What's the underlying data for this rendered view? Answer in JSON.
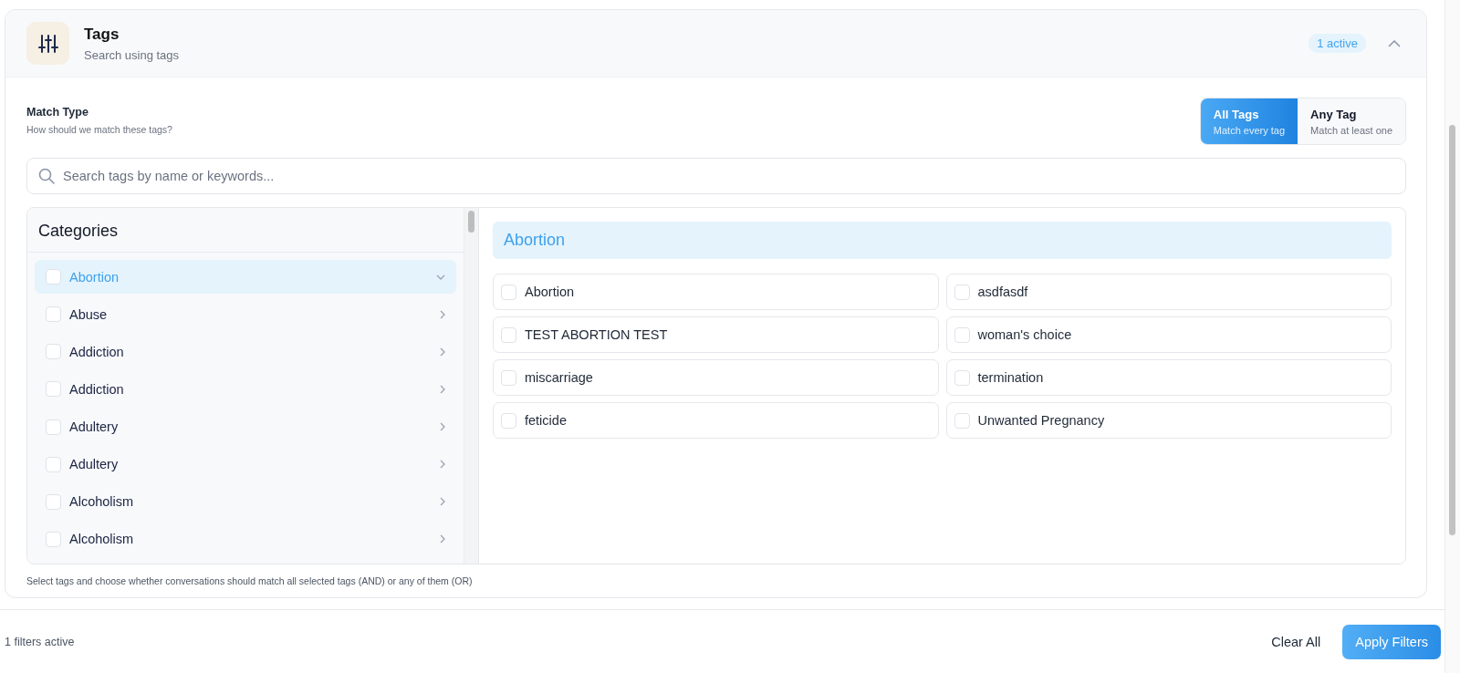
{
  "section": {
    "title": "Tags",
    "subtitle": "Search using tags",
    "badge": "1 active",
    "expanded": true
  },
  "match_type": {
    "label": "Match Type",
    "hint": "How should we match these tags?",
    "options": [
      {
        "label": "All Tags",
        "description": "Match every tag",
        "selected": true
      },
      {
        "label": "Any Tag",
        "description": "Match at least one",
        "selected": false
      }
    ]
  },
  "search": {
    "placeholder": "Search tags by name or keywords..."
  },
  "categories": {
    "title": "Categories",
    "items": [
      {
        "label": "Abortion",
        "checked": false,
        "selected": true,
        "expanded": true
      },
      {
        "label": "Abuse",
        "checked": false,
        "selected": false,
        "expanded": false
      },
      {
        "label": "Addiction",
        "checked": false,
        "selected": false,
        "expanded": false
      },
      {
        "label": "Addiction",
        "checked": false,
        "selected": false,
        "expanded": false
      },
      {
        "label": "Adultery",
        "checked": false,
        "selected": false,
        "expanded": false
      },
      {
        "label": "Adultery",
        "checked": false,
        "selected": false,
        "expanded": false
      },
      {
        "label": "Alcoholism",
        "checked": false,
        "selected": false,
        "expanded": false
      },
      {
        "label": "Alcoholism",
        "checked": false,
        "selected": false,
        "expanded": false
      }
    ]
  },
  "tag_panel": {
    "title": "Abortion",
    "tags": [
      {
        "label": "Abortion",
        "checked": false
      },
      {
        "label": "asdfasdf",
        "checked": false
      },
      {
        "label": "TEST ABORTION TEST",
        "checked": false
      },
      {
        "label": "woman's choice",
        "checked": false
      },
      {
        "label": "miscarriage",
        "checked": false
      },
      {
        "label": "termination",
        "checked": false
      },
      {
        "label": "feticide",
        "checked": false
      },
      {
        "label": "Unwanted Pregnancy",
        "checked": false
      }
    ]
  },
  "help_text": "Select tags and choose whether conversations should match all selected tags (AND) or any of them (OR)",
  "footer": {
    "status": "1 filters active",
    "buttons": [
      {
        "label": "Clear All",
        "kind": "text"
      },
      {
        "label": "Apply Filters",
        "kind": "primary"
      }
    ]
  }
}
